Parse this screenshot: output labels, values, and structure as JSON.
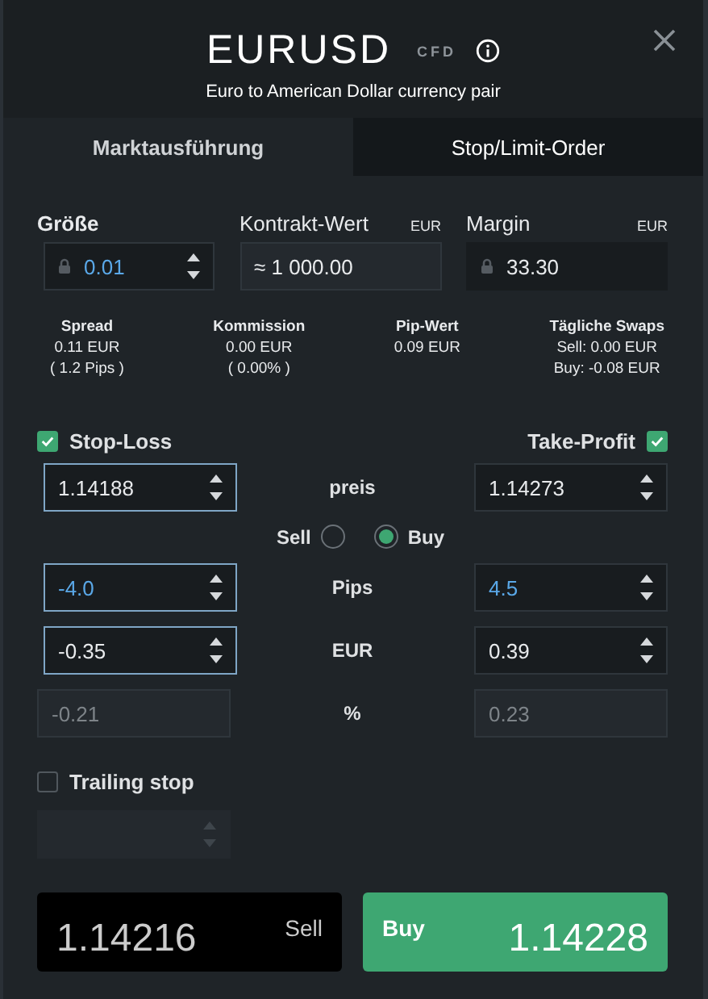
{
  "header": {
    "title": "EURUSD",
    "badge": "CFD",
    "subtitle": "Euro to American Dollar currency pair"
  },
  "tabs": [
    {
      "label": "Marktausführung",
      "selected": true
    },
    {
      "label": "Stop/Limit-Order",
      "selected": false
    }
  ],
  "top_fields": [
    {
      "label": "Größe",
      "value": "0.01",
      "locked": true,
      "kind": "spin",
      "accent": true
    },
    {
      "label": "Kontrakt-Wert",
      "unit": "EUR",
      "value": "≈ 1 000.00",
      "locked": false,
      "kind": "readonly",
      "accent": false
    },
    {
      "label": "Margin",
      "unit": "EUR",
      "value": "33.30",
      "locked": true,
      "kind": "plain",
      "accent": false
    }
  ],
  "stats": [
    {
      "label": "Spread",
      "lines": [
        "0.11 EUR",
        "( 1.2 Pips )"
      ]
    },
    {
      "label": "Kommission",
      "lines": [
        "0.00 EUR",
        "( 0.00% )"
      ]
    },
    {
      "label": "Pip-Wert",
      "lines": [
        "0.09 EUR"
      ]
    },
    {
      "label": "Tägliche Swaps",
      "lines": [
        "Sell: 0.00 EUR",
        "Buy: -0.08 EUR"
      ]
    }
  ],
  "stop_loss": {
    "label": "Stop-Loss",
    "checked": true
  },
  "take_profit": {
    "label": "Take-Profit",
    "checked": true
  },
  "direction": [
    {
      "label": "Sell",
      "selected": false
    },
    {
      "label": "Buy",
      "selected": true
    }
  ],
  "rows": [
    {
      "label": "preis",
      "kind": "spin",
      "left": {
        "value": "1.14188",
        "focused": true,
        "accent": false
      },
      "right": {
        "value": "1.14273",
        "focused": false,
        "accent": false
      }
    },
    {
      "label": "Pips",
      "kind": "spin",
      "left": {
        "value": "-4.0",
        "focused": true,
        "accent": true
      },
      "right": {
        "value": "4.5",
        "focused": false,
        "accent": true
      }
    },
    {
      "label": "EUR",
      "kind": "spin",
      "left": {
        "value": "-0.35",
        "focused": true,
        "accent": false
      },
      "right": {
        "value": "0.39",
        "focused": false,
        "accent": false
      }
    },
    {
      "label": "%",
      "kind": "readonly",
      "left": {
        "value": "-0.21",
        "focused": false,
        "accent": false
      },
      "right": {
        "value": "0.23",
        "focused": false,
        "accent": false
      }
    }
  ],
  "trailing_stop": {
    "label": "Trailing stop",
    "checked": false,
    "field_disabled": true
  },
  "sell": {
    "label": "Sell",
    "price": "1.14**21**6"
  },
  "buy": {
    "label": "Buy",
    "price": "1.14**22**8"
  }
}
